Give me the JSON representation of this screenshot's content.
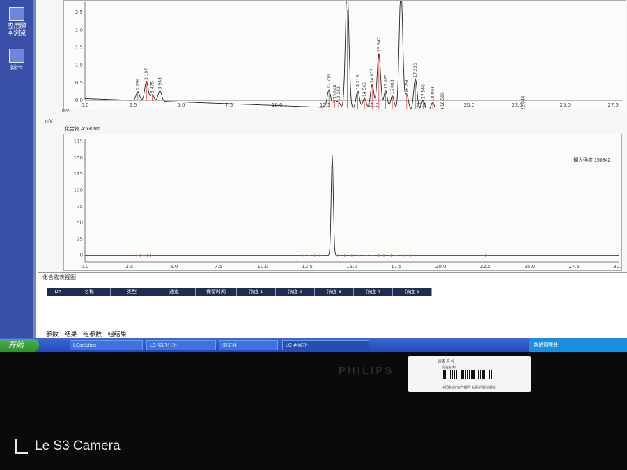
{
  "desktop": {
    "icons": [
      {
        "label": "应用脚\n本浏览",
        "icon": "folder-icon"
      },
      {
        "label": "网卡",
        "icon": "network-icon"
      }
    ]
  },
  "chart_data": [
    {
      "type": "line",
      "ylabel": "mV",
      "xlim": [
        0,
        28
      ],
      "ylim": [
        0,
        2.8
      ],
      "x_ticks": [
        "0.0",
        "2.5",
        "5.0",
        "7.5",
        "10.0",
        "12.5",
        "15.0",
        "17.5",
        "20.0",
        "22.5",
        "25.0",
        "27.5"
      ],
      "y_ticks": [
        "0.0",
        "0.5",
        "1.0",
        "1.5",
        "2.0",
        "2.5"
      ],
      "peaks": [
        {
          "x": 2.75,
          "h": 0.25,
          "label": "2.759"
        },
        {
          "x": 3.2,
          "h": 0.55,
          "label": "3.197"
        },
        {
          "x": 3.5,
          "h": 0.18,
          "label": "3.475"
        },
        {
          "x": 3.9,
          "h": 0.3,
          "label": "3.963"
        },
        {
          "x": 12.7,
          "h": 0.5,
          "label": "12.710"
        },
        {
          "x": 13.0,
          "h": 0.2,
          "label": "13.048"
        },
        {
          "x": 13.2,
          "h": 0.15,
          "label": "13.232"
        },
        {
          "x": 13.65,
          "h": 3.5,
          "label": ""
        },
        {
          "x": 14.2,
          "h": 0.5,
          "label": "14.218"
        },
        {
          "x": 14.55,
          "h": 0.3,
          "label": "14.545"
        },
        {
          "x": 14.95,
          "h": 0.7,
          "label": "14.977"
        },
        {
          "x": 15.3,
          "h": 1.6,
          "label": "15.347"
        },
        {
          "x": 15.65,
          "h": 0.55,
          "label": "15.625"
        },
        {
          "x": 16.0,
          "h": 0.4,
          "label": "16.003"
        },
        {
          "x": 16.45,
          "h": 3.5,
          "label": ""
        },
        {
          "x": 16.75,
          "h": 0.45,
          "label": "16.750"
        },
        {
          "x": 17.2,
          "h": 0.9,
          "label": "17.205"
        },
        {
          "x": 17.6,
          "h": 0.3,
          "label": "17.566"
        },
        {
          "x": 18.1,
          "h": 0.25,
          "label": "18.094"
        },
        {
          "x": 18.6,
          "h": 0.1,
          "label": "18.580"
        },
        {
          "x": 22.8,
          "h": 0.08,
          "label": "22.846"
        }
      ]
    },
    {
      "type": "line",
      "title": "化合物 A:530nm",
      "ylabel": "mV",
      "xlim": [
        0,
        30
      ],
      "ylim": [
        -10,
        180
      ],
      "x_ticks": [
        "0.0",
        "2.5",
        "5.0",
        "7.5",
        "10.0",
        "12.5",
        "15.0",
        "17.5",
        "20.0",
        "22.5",
        "25.0",
        "27.5",
        "30.0"
      ],
      "y_ticks": [
        "0",
        "25",
        "50",
        "75",
        "100",
        "125",
        "150",
        "175"
      ],
      "peaks": [
        {
          "x": 13.9,
          "h": 155
        }
      ],
      "marker_x": [
        2.9,
        3.1,
        3.3,
        3.5,
        3.7,
        12.3,
        12.6,
        12.9,
        13.2,
        14.2,
        14.6,
        15.0,
        15.4,
        15.8,
        16.2,
        16.5,
        16.8,
        17.2,
        17.5,
        17.9,
        18.3,
        22.5
      ],
      "right_label": "最大强度 150342"
    }
  ],
  "compound_table": {
    "title": "化合物表视图",
    "columns": [
      "ID#",
      "名称",
      "类型",
      "通道",
      "保留时间",
      "浓度 1",
      "浓度 2",
      "浓度 3",
      "浓度 4",
      "浓度 5"
    ]
  },
  "tabs": [
    "参数",
    "结果",
    "组参数",
    "组结果"
  ],
  "taskbar": {
    "start": "开始",
    "items": [
      "LCsolution",
      "LC 实时分析",
      "浏览器",
      "LC 再解析"
    ],
    "tray": "数据管理器"
  },
  "monitor": {
    "brand": "PHILIPS",
    "label_line1": "设备卡号",
    "label_line2": "设备名称",
    "label_line3": "中国移动/资产编号 粘贴后请勿撕除"
  },
  "watermark": "Le S3 Camera"
}
